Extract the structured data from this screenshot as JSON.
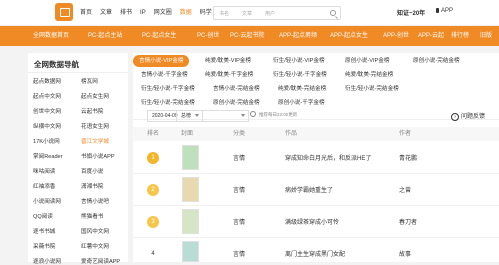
{
  "header": {
    "nav": [
      "首页",
      "文章",
      "排书",
      "IP",
      "网文圈",
      "数据",
      "码学"
    ],
    "active_nav": "数据",
    "search_segments": [
      "书名",
      "文章",
      "用户"
    ],
    "vip_label": "知证~20年",
    "app_label": "APP",
    "accent_color": "#f08a24"
  },
  "orange_nav": [
    "全网数据首页",
    "PC-起点主站",
    "PC-起点女生",
    "PC-创世",
    "PC-云起书院",
    "APP-起点男频",
    "APP-起点女生",
    "APP-创世",
    "APP-云起",
    "排行榜",
    "旧版"
  ],
  "sidebar": {
    "title": "全网数据导航",
    "items": [
      "起点数据网",
      "榜瓦网",
      "起点中文网",
      "起点女生网",
      "创世中文网",
      "云起书院",
      "纵横中文网",
      "花语女生网",
      "17K小说网",
      "晋江文学城",
      "掌阅Reader",
      "书旗小说APP",
      "咪咕阅读",
      "百度小说",
      "红袖添香",
      "潇湘书院",
      "小说阅读网",
      "言情小说吧",
      "QQ阅读",
      "熊猫看书",
      "逐书书城",
      "国风中文网",
      "采薇书院",
      "红薯中文网",
      "逐浪小说网",
      "爱奇艺阅读APP"
    ],
    "active": "晋江文学城"
  },
  "main": {
    "tags": [
      [
        "言情小说-VIP金榜",
        "纯爱/耽美-VIP金榜",
        "衍生/轻小说-VIP金榜",
        "原创小说-VIP金榜",
        "原创小说-完结金榜"
      ],
      [
        "言情小说-千字金榜",
        "纯爱/耽美-千字金榜",
        "衍生/轻小说-千字金榜",
        "纯爱/耽美-完结金榜"
      ],
      [
        "衍生/轻小说-千字金榜",
        "言情小说-完结金榜",
        "纯爱/耽美-完结金榜",
        "衍生/轻小说-完结金榜"
      ],
      [
        "衍生/轻小说-完结金榜",
        "原创小说-完结金榜",
        "原创小说-千字金榜"
      ]
    ],
    "active_tag": "言情小说-VIP金榜",
    "date_value": "2020-04-09",
    "sort_value": "总榜",
    "hint": "推荐每日22:00更新",
    "feedback": "问题反馈",
    "columns": [
      "排名",
      "封面",
      "分类",
      "作品",
      "作者"
    ],
    "rows": [
      {
        "rank": "1",
        "category": "言情",
        "title": "穿成知命白月光后，和反派HE了",
        "author": "青花鹏",
        "rank_color": "#f5b52b"
      },
      {
        "rank": "2",
        "category": "言情",
        "title": "病娇学霸她重生了",
        "author": "之曾",
        "rank_color": "#f5b52b"
      },
      {
        "rank": "3",
        "category": "言情",
        "title": "满级绿茶穿成小可怜",
        "author": "春刀者",
        "rank_color": "#f5b52b"
      },
      {
        "rank": "4",
        "category": "言情",
        "title": "离门主生穿成黑门女配",
        "author": "故事",
        "rank_color": ""
      }
    ]
  }
}
